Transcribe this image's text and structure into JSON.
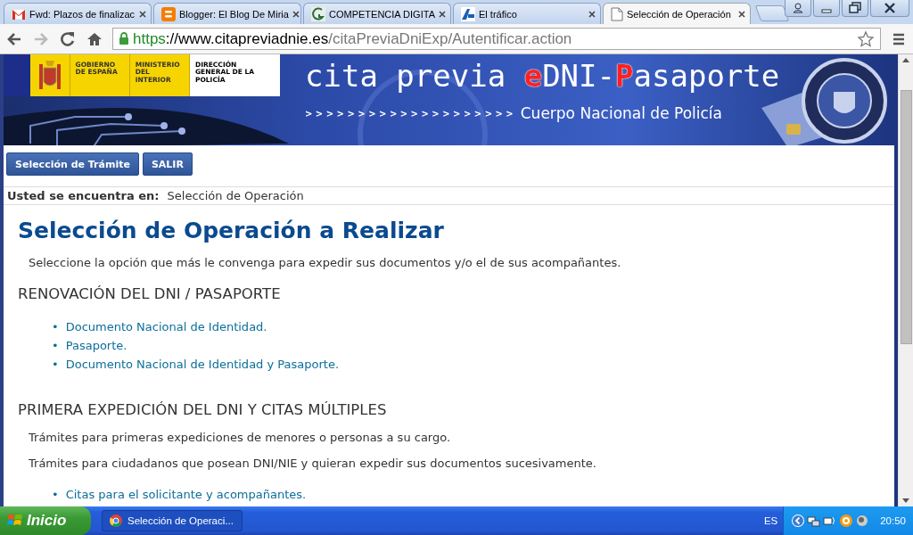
{
  "browser": {
    "tabs": [
      {
        "title": "Fwd: Plazos de finalizac",
        "selected": false
      },
      {
        "title": "Blogger: El Blog De Miria",
        "selected": false
      },
      {
        "title": "COMPETENCIA DIGITA",
        "selected": false
      },
      {
        "title": "El tráfico",
        "selected": false
      },
      {
        "title": "Selección de Operación",
        "selected": true
      }
    ],
    "url": {
      "scheme": "https",
      "host": "://www.citapreviadnie.es",
      "path": "/citaPreviaDniExp/Autentificar.action"
    }
  },
  "banner": {
    "logos": [
      "GOBIERNO DE ESPAÑA",
      "MINISTERIO DEL INTERIOR",
      "DIRECCIÓN GENERAL DE LA POLICÍA"
    ],
    "title": [
      {
        "text": "cita previa ",
        "accent": false
      },
      {
        "text": "e",
        "accent": true
      },
      {
        "text": "DNI-",
        "accent": false
      },
      {
        "text": "P",
        "accent": true
      },
      {
        "text": "asaporte",
        "accent": false
      }
    ],
    "arrows": "> > > > > > > > > > > > > > > > > > > >",
    "subtitle": "Cuerpo Nacional de Policía"
  },
  "nav": [
    "Selección de Trámite",
    "SALIR"
  ],
  "breadcrumb": {
    "label": "Usted se encuentra en:",
    "current": "Selección de Operación"
  },
  "content": {
    "heading": "Selección de Operación a Realizar",
    "intro": "Seleccione la opción que más le convenga para expedir sus documentos y/o el de sus acompañantes.",
    "sections": [
      {
        "title": "RENOVACIÓN DEL DNI / PASAPORTE",
        "marker": "•",
        "links": [
          "Documento Nacional de Identidad.",
          "Pasaporte.",
          "Documento Nacional de Identidad y Pasaporte."
        ]
      },
      {
        "title": "PRIMERA EXPEDICIÓN DEL DNI Y CITAS MÚLTIPLES",
        "texts": [
          "Trámites para primeras expediciones de menores o personas a su cargo.",
          "Trámites para ciudadanos que posean DNI/NIE y quieran expedir sus documentos sucesivamente."
        ],
        "marker": "•",
        "links": [
          "Citas para el solicitante y acompañantes."
        ]
      }
    ]
  },
  "taskbar": {
    "start": "Inicio",
    "tasks": [
      "Selección de Operaci..."
    ],
    "language": "ES",
    "time": "20:50"
  }
}
